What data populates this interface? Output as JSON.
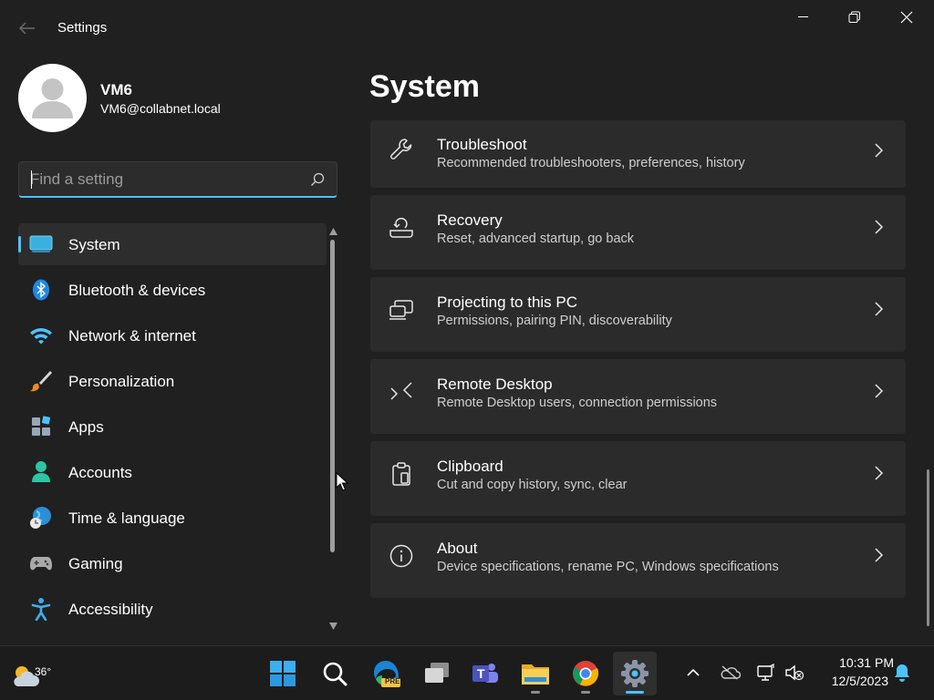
{
  "window": {
    "title": "Settings",
    "controls": {
      "minimize": "minimize-icon",
      "maximize": "restore-icon",
      "close": "close-icon"
    }
  },
  "profile": {
    "name": "VM6",
    "email": "VM6@collabnet.local"
  },
  "search": {
    "placeholder": "Find a setting",
    "value": ""
  },
  "nav": {
    "items": [
      {
        "label": "System",
        "icon": "system-icon",
        "active": true
      },
      {
        "label": "Bluetooth & devices",
        "icon": "bluetooth-icon"
      },
      {
        "label": "Network & internet",
        "icon": "wifi-icon"
      },
      {
        "label": "Personalization",
        "icon": "brush-icon"
      },
      {
        "label": "Apps",
        "icon": "apps-icon"
      },
      {
        "label": "Accounts",
        "icon": "accounts-icon"
      },
      {
        "label": "Time & language",
        "icon": "globe-clock-icon"
      },
      {
        "label": "Gaming",
        "icon": "gamepad-icon"
      },
      {
        "label": "Accessibility",
        "icon": "accessibility-icon"
      }
    ]
  },
  "main": {
    "title": "System",
    "cards": [
      {
        "title": "Troubleshoot",
        "desc": "Recommended troubleshooters, preferences, history",
        "icon": "wrench-icon"
      },
      {
        "title": "Recovery",
        "desc": "Reset, advanced startup, go back",
        "icon": "recovery-icon"
      },
      {
        "title": "Projecting to this PC",
        "desc": "Permissions, pairing PIN, discoverability",
        "icon": "projecting-icon"
      },
      {
        "title": "Remote Desktop",
        "desc": "Remote Desktop users, connection permissions",
        "icon": "remote-desktop-icon"
      },
      {
        "title": "Clipboard",
        "desc": "Cut and copy history, sync, clear",
        "icon": "clipboard-icon"
      },
      {
        "title": "About",
        "desc": "Device specifications, rename PC, Windows specifications",
        "icon": "info-icon"
      }
    ]
  },
  "taskbar": {
    "weather": {
      "temp": "36°",
      "icon": "weather-cloud-sun-icon"
    },
    "apps": [
      {
        "name": "start",
        "icon": "windows-start-icon"
      },
      {
        "name": "search",
        "icon": "search-icon"
      },
      {
        "name": "edge-pre",
        "icon": "edge-pre-icon",
        "badge": "PRE"
      },
      {
        "name": "task-view",
        "icon": "task-view-icon"
      },
      {
        "name": "teams",
        "icon": "teams-icon",
        "letter": "T"
      },
      {
        "name": "file-explorer",
        "icon": "folder-icon"
      },
      {
        "name": "chrome",
        "icon": "chrome-icon"
      },
      {
        "name": "settings",
        "icon": "gear-icon",
        "active": true
      }
    ],
    "tray": {
      "icons": [
        "chevron-up-icon",
        "onedrive-icon",
        "network-icon",
        "speaker-muted-icon",
        "notification-bell-icon"
      ],
      "time": "10:31 PM",
      "date": "12/5/2023"
    }
  },
  "colors": {
    "accent": "#4cc2ff",
    "window_bg": "#202020",
    "card_bg": "#2b2b2b",
    "taskbar_bg": "#1c1c1c"
  }
}
